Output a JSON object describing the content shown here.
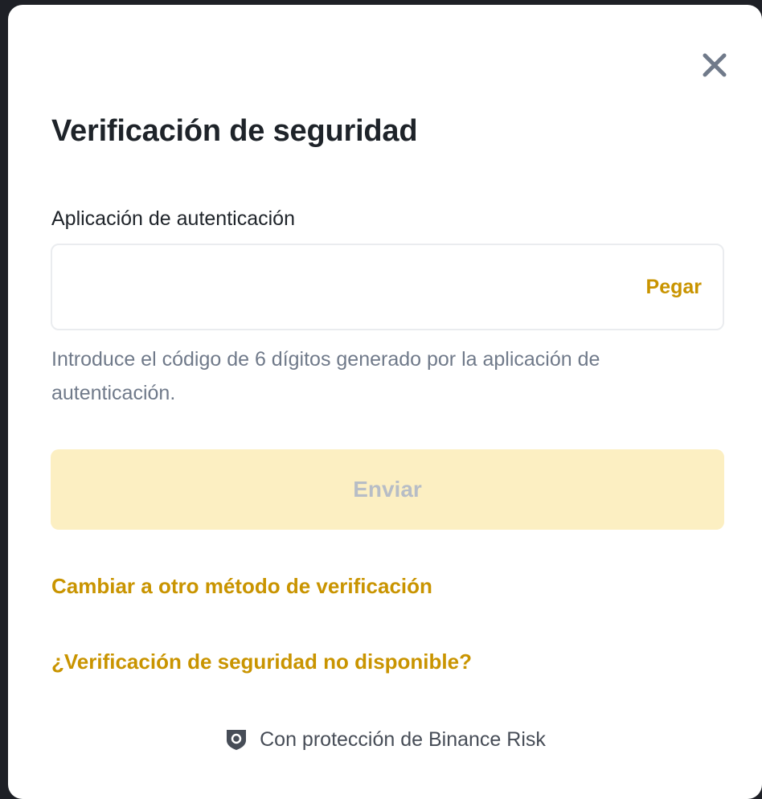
{
  "modal": {
    "title": "Verificación de seguridad",
    "close_icon": "close-icon"
  },
  "field": {
    "label": "Aplicación de autenticación",
    "value": "",
    "placeholder": "",
    "paste_label": "Pegar",
    "hint": "Introduce el código de 6 dígitos generado por la aplicación de autenticación."
  },
  "submit": {
    "label": "Enviar",
    "disabled": true
  },
  "links": {
    "switch_method": "Cambiar a otro método de verificación",
    "unavailable": "¿Verificación de seguridad no disponible?"
  },
  "footer": {
    "icon": "shield-icon",
    "text": "Con protección de Binance Risk"
  },
  "colors": {
    "accent": "#c99400",
    "submit_bg_disabled": "#fcefc2",
    "submit_text_disabled": "#b7bdc6",
    "title": "#1e2329",
    "hint": "#707a8a"
  }
}
